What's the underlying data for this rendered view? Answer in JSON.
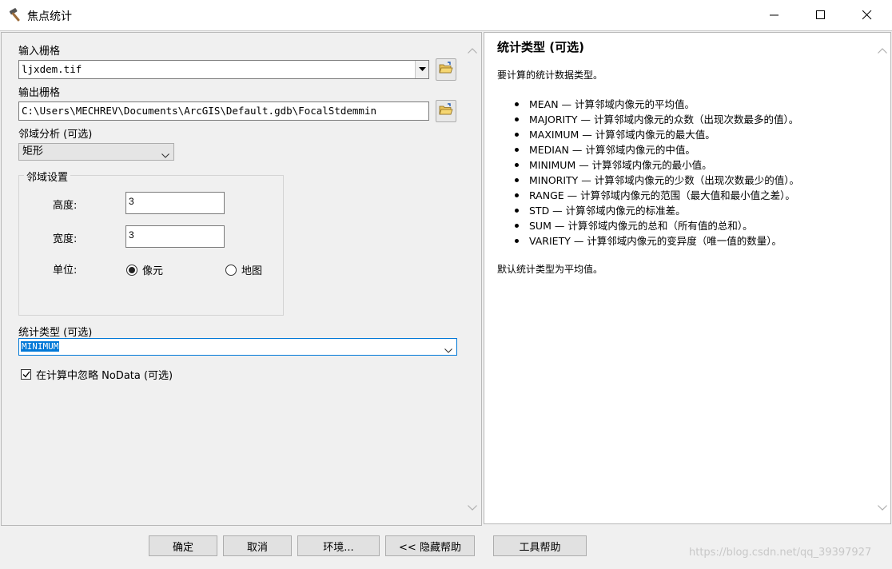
{
  "window": {
    "title": "焦点统计",
    "icon": "hammer-icon",
    "minimize_icon": "minimize-icon",
    "maximize_icon": "maximize-icon",
    "close_icon": "close-icon"
  },
  "form": {
    "input_raster": {
      "label": "输入栅格",
      "value": "ljxdem.tif"
    },
    "output_raster": {
      "label": "输出栅格",
      "value": "C:\\Users\\MECHREV\\Documents\\ArcGIS\\Default.gdb\\FocalStdemmin"
    },
    "neighborhood": {
      "label": "邻域分析 (可选)",
      "value": "矩形"
    },
    "neighborhood_settings": {
      "legend": "邻域设置",
      "height": {
        "label": "高度:",
        "value": "3"
      },
      "width": {
        "label": "宽度:",
        "value": "3"
      },
      "units": {
        "label": "单位:",
        "options": [
          {
            "label": "像元",
            "selected": true
          },
          {
            "label": "地图",
            "selected": false
          }
        ]
      }
    },
    "statistics_type": {
      "label": "统计类型 (可选)",
      "value": "MINIMUM"
    },
    "ignore_nodata": {
      "label": "在计算中忽略 NoData (可选)",
      "checked": true
    }
  },
  "help": {
    "title": "统计类型 (可选)",
    "intro": "要计算的统计数据类型。",
    "items": [
      "MEAN — 计算邻域内像元的平均值。",
      "MAJORITY — 计算邻域内像元的众数（出现次数最多的值）。",
      "MAXIMUM — 计算邻域内像元的最大值。",
      "MEDIAN — 计算邻域内像元的中值。",
      "MINIMUM — 计算邻域内像元的最小值。",
      "MINORITY — 计算邻域内像元的少数（出现次数最少的值）。",
      "RANGE — 计算邻域内像元的范围（最大值和最小值之差）。",
      "STD — 计算邻域内像元的标准差。",
      "SUM — 计算邻域内像元的总和（所有值的总和）。",
      "VARIETY — 计算邻域内像元的变异度（唯一值的数量）。"
    ],
    "footer": "默认统计类型为平均值。"
  },
  "buttons": {
    "ok": "确定",
    "cancel": "取消",
    "environments": "环境...",
    "hide_help": "<< 隐藏帮助",
    "tool_help": "工具帮助"
  },
  "watermark": "https://blog.csdn.net/qq_39397927"
}
